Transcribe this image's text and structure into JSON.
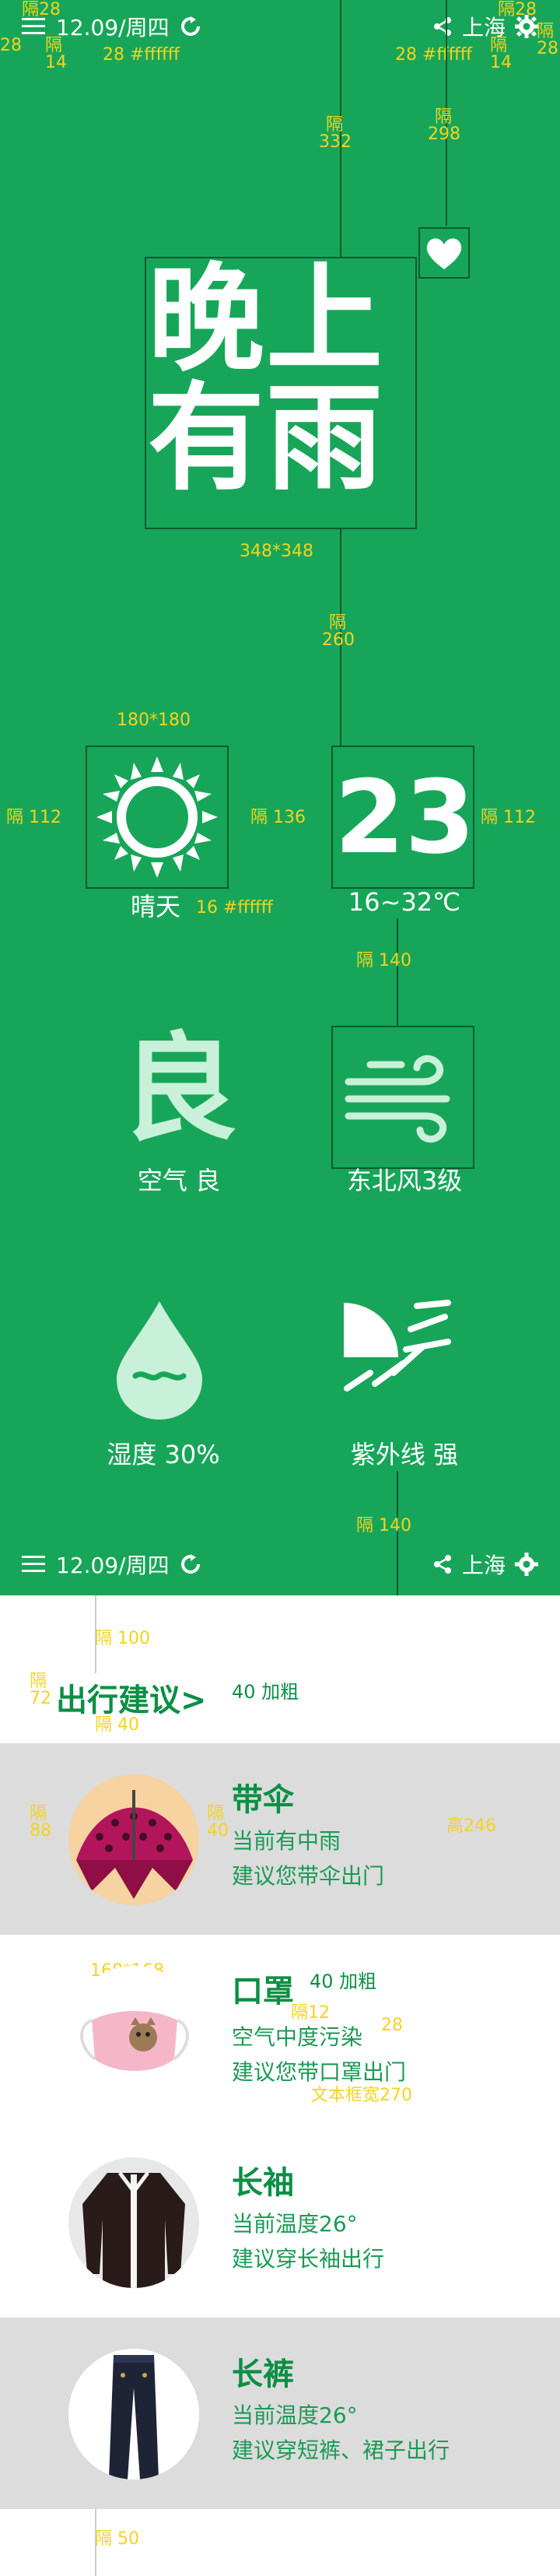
{
  "colors": {
    "brand_green": "#17a659",
    "text_green": "#0b8f45",
    "annotation": "#f5d31d",
    "gray_row": "#dcdcdc"
  },
  "header": {
    "date": "12.09/周四",
    "city": "上海"
  },
  "hero": {
    "line1": "晚上",
    "line2": "有雨"
  },
  "weather": {
    "condition": "晴天",
    "temperature": "23",
    "range": "16~32℃"
  },
  "details": {
    "air_char": "良",
    "air_label": "空气 良",
    "wind_label": "东北风3级",
    "humidity_label": "湿度 30%",
    "uv_label": "紫外线 强"
  },
  "advice": {
    "title": "出行建议>",
    "items": [
      {
        "title": "带伞",
        "line1": "当前有中雨",
        "line2": "建议您带伞出门"
      },
      {
        "title": "口罩",
        "line1": "空气中度污染",
        "line2": "建议您带口罩出门"
      },
      {
        "title": "长袖",
        "line1": "当前温度26°",
        "line2": "建议穿长袖出行"
      },
      {
        "title": "长裤",
        "line1": "当前温度26°",
        "line2": "建议穿短裤、裙子出行"
      }
    ]
  },
  "annotations": {
    "gap28": "隔28",
    "n28": "28",
    "gap14": "隔14",
    "font28": "28 #ffffff",
    "gap332": "隔332",
    "gap298": "隔298",
    "size348": "348*348",
    "gap260": "隔260",
    "size180": "180*180",
    "gap112": "隔 112",
    "gap136": "隔 136",
    "font16": "16 #ffffff",
    "gap140": "隔 140",
    "gap100": "隔 100",
    "gap72": "隔72",
    "bold40": "40 加粗",
    "gap40": "隔 40",
    "gap88": "隔88",
    "gap40b": "隔40",
    "height246": "高246",
    "size168": "168*168",
    "gap12": "隔12",
    "width270": "文本框宽270",
    "gap50": "隔 50"
  }
}
